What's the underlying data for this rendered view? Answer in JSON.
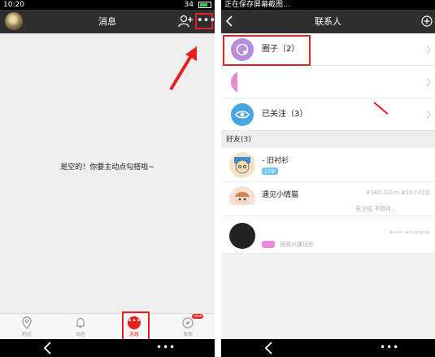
{
  "left": {
    "status": {
      "time": "10:20",
      "battery": "34"
    },
    "header": {
      "title": "消息",
      "more_glyph": "•••"
    },
    "empty_message": "是空的！你要主动点勾搭啦~",
    "nav": [
      {
        "label": "附近",
        "icon": "location-pin-icon"
      },
      {
        "label": "动态",
        "icon": "bell-icon"
      },
      {
        "label": "消息",
        "icon": "chat-bubble-icon",
        "active": true,
        "glyph": "•••"
      },
      {
        "label": "发现",
        "icon": "compass-icon",
        "badge": "new"
      }
    ],
    "sysnav_dots": "•••"
  },
  "right": {
    "status": {
      "text": "正在保存屏幕截图..."
    },
    "header": {
      "title": "联系人"
    },
    "rows": [
      {
        "label": "圈子（2）",
        "icon_color": "#b68ee0"
      },
      {
        "label": "",
        "icon_color": "#e78ad3"
      },
      {
        "label": "已关注（3）",
        "icon_color": "#46a6e0"
      }
    ],
    "section_title": "好友(3)",
    "friends": [
      {
        "name": "- 旧衬衫",
        "tag": "17岁",
        "tag_color": "#6fc7f0",
        "meta": "",
        "sub": ""
      },
      {
        "name": "遇见小情猫",
        "tag": "",
        "tag_color": "",
        "meta": "#366.32km #18小时前",
        "sub": "关注啦 不但可..."
      },
      {
        "name": "",
        "tag": "",
        "tag_color": "#e88bd6",
        "meta": "#0m #4分钟前",
        "sub": "很高兴遇见你"
      }
    ],
    "sysnav_dots": "•••"
  },
  "colors": {
    "accent_red": "#e8201f",
    "header_dark": "#2f2f2f"
  }
}
